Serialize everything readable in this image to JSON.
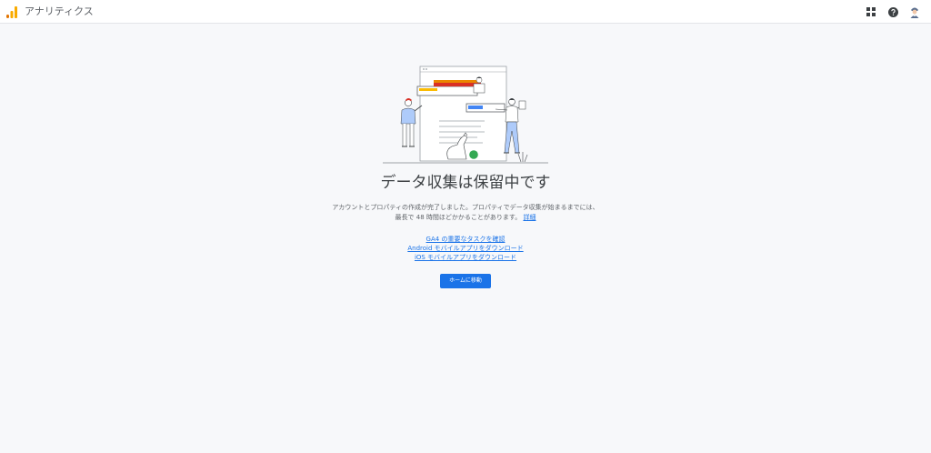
{
  "header": {
    "app_title": "アナリティクス",
    "icons": [
      "apps-icon",
      "help-icon",
      "avatar"
    ]
  },
  "main": {
    "heading": "データ収集は保留中です",
    "description_line1": "アカウントとプロパティの作成が完了しました。プロパティでデータ収集が始まるまでには、",
    "description_line2": "最長で 48 時間ほどかかることがあります。",
    "details_link": "詳細",
    "links": [
      "GA4 の重要なタスクを確認",
      "Android モバイルアプリをダウンロード",
      "iOS モバイルアプリをダウンロード"
    ],
    "home_button": "ホームに移動"
  },
  "colors": {
    "accent": "#1a73e8",
    "logo_orange": "#f9ab00",
    "logo_dark_orange": "#e37400"
  }
}
